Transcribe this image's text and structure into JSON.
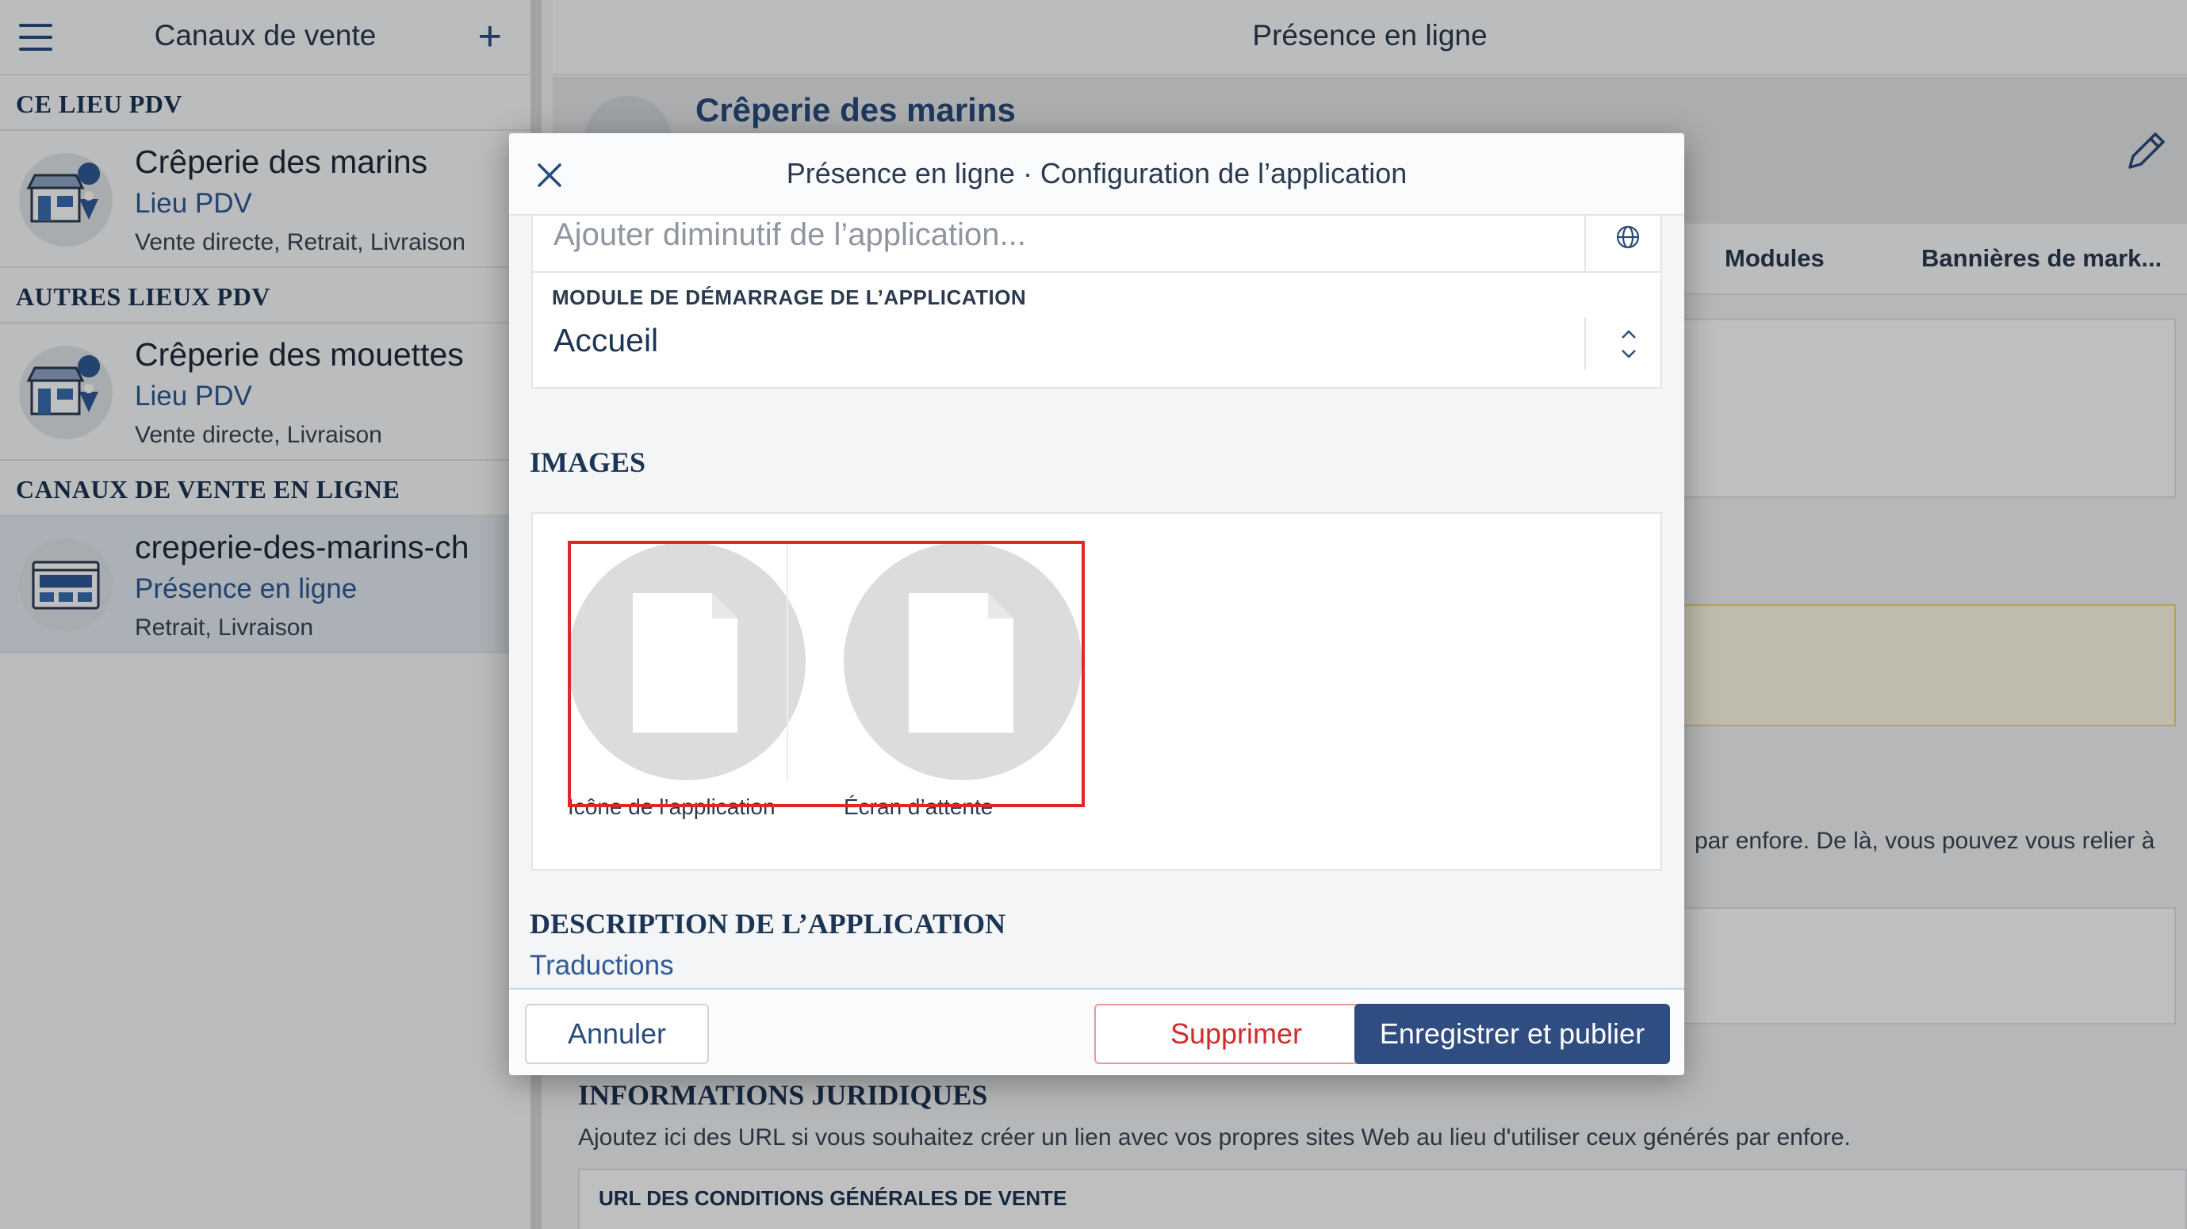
{
  "sidebar": {
    "title": "Canaux de vente",
    "sections": [
      {
        "title": "CE LIEU PDV"
      },
      {
        "title": "AUTRES LIEUX PDV"
      },
      {
        "title": "CANAUX DE VENTE EN LIGNE"
      }
    ],
    "items": [
      {
        "name": "Crêperie des marins",
        "type": "Lieu PDV",
        "sub": "Vente directe, Retrait, Livraison",
        "icon": "store-location-icon"
      },
      {
        "name": "Crêperie des mouettes",
        "type": "Lieu PDV",
        "sub": "Vente directe, Livraison",
        "icon": "store-location-icon"
      },
      {
        "name": "creperie-des-marins-ch",
        "type": "Présence en ligne",
        "sub": "Retrait, Livraison",
        "icon": "browser-window-icon",
        "selected": true
      }
    ]
  },
  "main": {
    "header_title": "Présence en ligne",
    "banner_title": "Crêperie des marins",
    "tabs": [
      {
        "label": "Modules"
      },
      {
        "label": "Bannières de mark..."
      }
    ],
    "body_text_fragment": "par enfore. De là, vous pouvez vous relier à",
    "legal_title": "INFORMATIONS JURIDIQUES",
    "legal_description": "Ajoutez ici des URL si vous souhaitez créer un lien avec vos propres sites Web au lieu d'utiliser ceux générés par enfore.",
    "legal_field_label": "URL DES CONDITIONS GÉNÉRALES DE VENTE"
  },
  "modal": {
    "title": "Présence en ligne · Configuration de l’application",
    "short_name_placeholder": "Ajouter diminutif de l’application...",
    "start_module_label": "MODULE DE DÉMARRAGE DE L’APPLICATION",
    "start_module_value": "Accueil",
    "images_title": "IMAGES",
    "images": [
      {
        "caption": "Icône de l’application"
      },
      {
        "caption": "Écran d’attente"
      }
    ],
    "description_title": "DESCRIPTION DE L’APPLICATION",
    "translations_link": "Traductions",
    "buttons": {
      "cancel": "Annuler",
      "delete": "Supprimer",
      "publish": "Enregistrer et publier"
    }
  },
  "colors": {
    "accent": "#2f4d80",
    "danger": "#d42a2a",
    "highlight": "#e32525"
  }
}
